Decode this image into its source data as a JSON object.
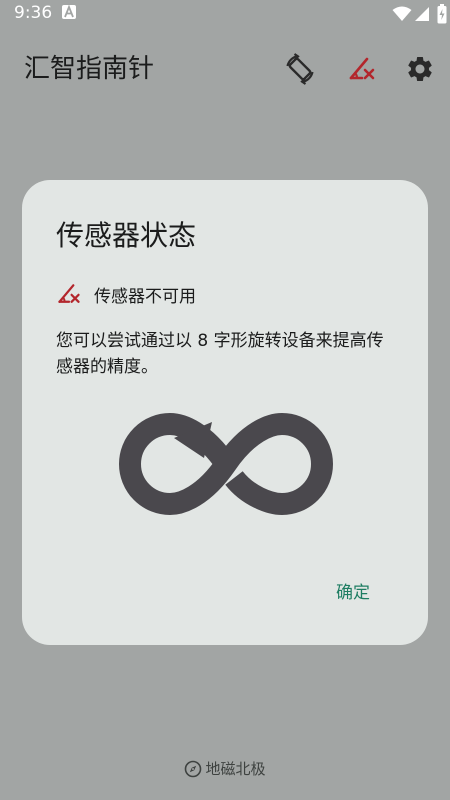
{
  "status_bar": {
    "time": "9:36"
  },
  "app_bar": {
    "title": "汇智指南针",
    "icons": [
      "screen-rotation-icon",
      "sensor-unavailable-icon",
      "gear-icon"
    ]
  },
  "dialog": {
    "title": "传感器状态",
    "status_label": "传感器不可用",
    "message": "您可以尝试通过以 8 字形旋转设备来提高传感器的精度。",
    "confirm_label": "确定"
  },
  "footer": {
    "north_reference": "地磁北极"
  },
  "colors": {
    "background": "#a2a5a4",
    "dialog": "#e2e6e4",
    "accent": "#1e7d62",
    "error": "#b3262c",
    "figure": "#4a484d"
  }
}
